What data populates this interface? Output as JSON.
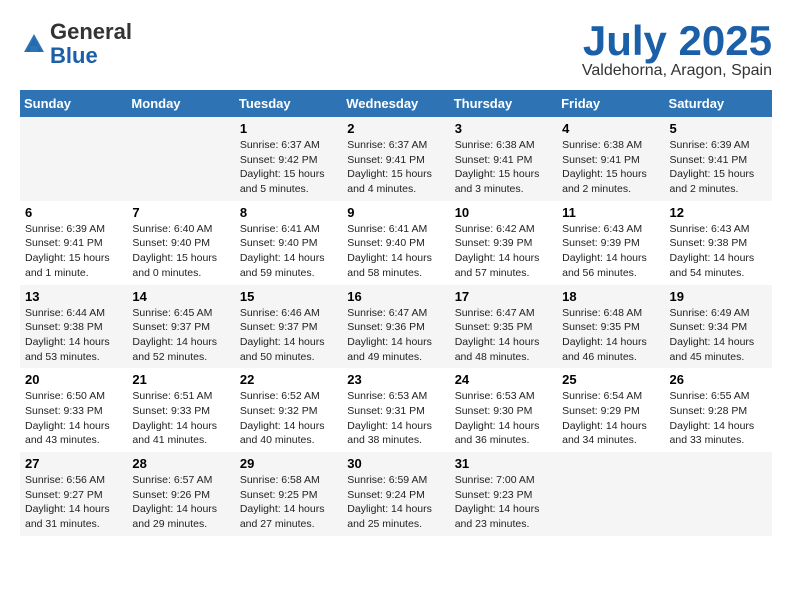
{
  "header": {
    "logo_general": "General",
    "logo_blue": "Blue",
    "month_title": "July 2025",
    "location": "Valdehorna, Aragon, Spain"
  },
  "weekdays": [
    "Sunday",
    "Monday",
    "Tuesday",
    "Wednesday",
    "Thursday",
    "Friday",
    "Saturday"
  ],
  "weeks": [
    [
      {
        "day": "",
        "sunrise": "",
        "sunset": "",
        "daylight": ""
      },
      {
        "day": "",
        "sunrise": "",
        "sunset": "",
        "daylight": ""
      },
      {
        "day": "1",
        "sunrise": "Sunrise: 6:37 AM",
        "sunset": "Sunset: 9:42 PM",
        "daylight": "Daylight: 15 hours and 5 minutes."
      },
      {
        "day": "2",
        "sunrise": "Sunrise: 6:37 AM",
        "sunset": "Sunset: 9:41 PM",
        "daylight": "Daylight: 15 hours and 4 minutes."
      },
      {
        "day": "3",
        "sunrise": "Sunrise: 6:38 AM",
        "sunset": "Sunset: 9:41 PM",
        "daylight": "Daylight: 15 hours and 3 minutes."
      },
      {
        "day": "4",
        "sunrise": "Sunrise: 6:38 AM",
        "sunset": "Sunset: 9:41 PM",
        "daylight": "Daylight: 15 hours and 2 minutes."
      },
      {
        "day": "5",
        "sunrise": "Sunrise: 6:39 AM",
        "sunset": "Sunset: 9:41 PM",
        "daylight": "Daylight: 15 hours and 2 minutes."
      }
    ],
    [
      {
        "day": "6",
        "sunrise": "Sunrise: 6:39 AM",
        "sunset": "Sunset: 9:41 PM",
        "daylight": "Daylight: 15 hours and 1 minute."
      },
      {
        "day": "7",
        "sunrise": "Sunrise: 6:40 AM",
        "sunset": "Sunset: 9:40 PM",
        "daylight": "Daylight: 15 hours and 0 minutes."
      },
      {
        "day": "8",
        "sunrise": "Sunrise: 6:41 AM",
        "sunset": "Sunset: 9:40 PM",
        "daylight": "Daylight: 14 hours and 59 minutes."
      },
      {
        "day": "9",
        "sunrise": "Sunrise: 6:41 AM",
        "sunset": "Sunset: 9:40 PM",
        "daylight": "Daylight: 14 hours and 58 minutes."
      },
      {
        "day": "10",
        "sunrise": "Sunrise: 6:42 AM",
        "sunset": "Sunset: 9:39 PM",
        "daylight": "Daylight: 14 hours and 57 minutes."
      },
      {
        "day": "11",
        "sunrise": "Sunrise: 6:43 AM",
        "sunset": "Sunset: 9:39 PM",
        "daylight": "Daylight: 14 hours and 56 minutes."
      },
      {
        "day": "12",
        "sunrise": "Sunrise: 6:43 AM",
        "sunset": "Sunset: 9:38 PM",
        "daylight": "Daylight: 14 hours and 54 minutes."
      }
    ],
    [
      {
        "day": "13",
        "sunrise": "Sunrise: 6:44 AM",
        "sunset": "Sunset: 9:38 PM",
        "daylight": "Daylight: 14 hours and 53 minutes."
      },
      {
        "day": "14",
        "sunrise": "Sunrise: 6:45 AM",
        "sunset": "Sunset: 9:37 PM",
        "daylight": "Daylight: 14 hours and 52 minutes."
      },
      {
        "day": "15",
        "sunrise": "Sunrise: 6:46 AM",
        "sunset": "Sunset: 9:37 PM",
        "daylight": "Daylight: 14 hours and 50 minutes."
      },
      {
        "day": "16",
        "sunrise": "Sunrise: 6:47 AM",
        "sunset": "Sunset: 9:36 PM",
        "daylight": "Daylight: 14 hours and 49 minutes."
      },
      {
        "day": "17",
        "sunrise": "Sunrise: 6:47 AM",
        "sunset": "Sunset: 9:35 PM",
        "daylight": "Daylight: 14 hours and 48 minutes."
      },
      {
        "day": "18",
        "sunrise": "Sunrise: 6:48 AM",
        "sunset": "Sunset: 9:35 PM",
        "daylight": "Daylight: 14 hours and 46 minutes."
      },
      {
        "day": "19",
        "sunrise": "Sunrise: 6:49 AM",
        "sunset": "Sunset: 9:34 PM",
        "daylight": "Daylight: 14 hours and 45 minutes."
      }
    ],
    [
      {
        "day": "20",
        "sunrise": "Sunrise: 6:50 AM",
        "sunset": "Sunset: 9:33 PM",
        "daylight": "Daylight: 14 hours and 43 minutes."
      },
      {
        "day": "21",
        "sunrise": "Sunrise: 6:51 AM",
        "sunset": "Sunset: 9:33 PM",
        "daylight": "Daylight: 14 hours and 41 minutes."
      },
      {
        "day": "22",
        "sunrise": "Sunrise: 6:52 AM",
        "sunset": "Sunset: 9:32 PM",
        "daylight": "Daylight: 14 hours and 40 minutes."
      },
      {
        "day": "23",
        "sunrise": "Sunrise: 6:53 AM",
        "sunset": "Sunset: 9:31 PM",
        "daylight": "Daylight: 14 hours and 38 minutes."
      },
      {
        "day": "24",
        "sunrise": "Sunrise: 6:53 AM",
        "sunset": "Sunset: 9:30 PM",
        "daylight": "Daylight: 14 hours and 36 minutes."
      },
      {
        "day": "25",
        "sunrise": "Sunrise: 6:54 AM",
        "sunset": "Sunset: 9:29 PM",
        "daylight": "Daylight: 14 hours and 34 minutes."
      },
      {
        "day": "26",
        "sunrise": "Sunrise: 6:55 AM",
        "sunset": "Sunset: 9:28 PM",
        "daylight": "Daylight: 14 hours and 33 minutes."
      }
    ],
    [
      {
        "day": "27",
        "sunrise": "Sunrise: 6:56 AM",
        "sunset": "Sunset: 9:27 PM",
        "daylight": "Daylight: 14 hours and 31 minutes."
      },
      {
        "day": "28",
        "sunrise": "Sunrise: 6:57 AM",
        "sunset": "Sunset: 9:26 PM",
        "daylight": "Daylight: 14 hours and 29 minutes."
      },
      {
        "day": "29",
        "sunrise": "Sunrise: 6:58 AM",
        "sunset": "Sunset: 9:25 PM",
        "daylight": "Daylight: 14 hours and 27 minutes."
      },
      {
        "day": "30",
        "sunrise": "Sunrise: 6:59 AM",
        "sunset": "Sunset: 9:24 PM",
        "daylight": "Daylight: 14 hours and 25 minutes."
      },
      {
        "day": "31",
        "sunrise": "Sunrise: 7:00 AM",
        "sunset": "Sunset: 9:23 PM",
        "daylight": "Daylight: 14 hours and 23 minutes."
      },
      {
        "day": "",
        "sunrise": "",
        "sunset": "",
        "daylight": ""
      },
      {
        "day": "",
        "sunrise": "",
        "sunset": "",
        "daylight": ""
      }
    ]
  ]
}
